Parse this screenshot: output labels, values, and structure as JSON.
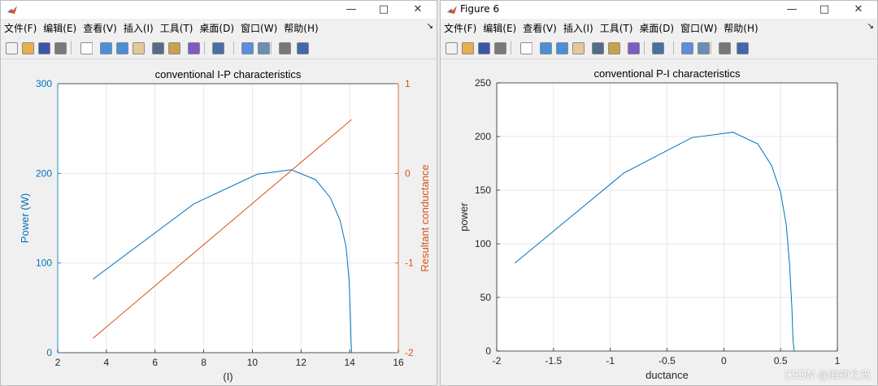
{
  "windows": [
    {
      "id": "w1",
      "title": ""
    },
    {
      "id": "w2",
      "title": "Figure 6"
    }
  ],
  "menus": [
    "文件(F)",
    "编辑(E)",
    "查看(V)",
    "插入(I)",
    "工具(T)",
    "桌面(D)",
    "窗口(W)",
    "帮助(H)"
  ],
  "toolbar_icons": [
    "new-file-icon",
    "open-folder-icon",
    "save-icon",
    "print-icon",
    "pointer-icon",
    "zoom-in-icon",
    "zoom-out-icon",
    "pan-icon",
    "rotate-3d-icon",
    "data-cursor-icon",
    "brush-icon",
    "link-plot-icon",
    "colorbar-icon",
    "legend-icon",
    "hide-plot-tools-icon",
    "show-plot-tools-icon"
  ],
  "colors": {
    "blue": "#0072BD",
    "orange": "#D95319",
    "axis": "#262626",
    "grid": "#e6e6e6"
  },
  "watermark": "CSDN @海神之光",
  "chart_data": [
    {
      "type": "line",
      "title": "conventional I-P characteristics",
      "xlabel": "(I)",
      "ylabel": "Power (W)",
      "ylabel_right": "Resultant conductance",
      "xlim": [
        2,
        16
      ],
      "ylim": [
        0,
        300
      ],
      "ylim_right": [
        -2,
        1
      ],
      "xticks": [
        2,
        4,
        6,
        8,
        10,
        12,
        14,
        16
      ],
      "yticks": [
        0,
        100,
        200,
        300
      ],
      "yticks_right": [
        -2,
        -1,
        0,
        1
      ],
      "grid": true,
      "series": [
        {
          "axis": "left",
          "color": "#0072BD",
          "x": [
            3.45,
            7.6,
            10.2,
            11.6,
            12.6,
            13.2,
            13.6,
            13.85,
            13.98,
            14.03,
            14.06,
            14.08
          ],
          "y": [
            82,
            166,
            199,
            204,
            193,
            173,
            148,
            118,
            80,
            40,
            10,
            0
          ]
        },
        {
          "axis": "right",
          "color": "#D95319",
          "x": [
            3.45,
            14.08
          ],
          "y": [
            -1.84,
            0.6
          ]
        }
      ]
    },
    {
      "type": "line",
      "title": "conventional P-I characteristics",
      "xlabel": "ductance",
      "ylabel": "power",
      "xlim": [
        -2,
        1
      ],
      "ylim": [
        0,
        250
      ],
      "xticks": [
        -2,
        -1.5,
        -1,
        -0.5,
        0,
        0.5,
        1
      ],
      "yticks": [
        0,
        50,
        100,
        150,
        200,
        250
      ],
      "grid": true,
      "series": [
        {
          "color": "#0072BD",
          "x": [
            -1.84,
            -0.88,
            -0.28,
            0.08,
            0.3,
            0.42,
            0.5,
            0.55,
            0.58,
            0.6,
            0.61,
            0.62
          ],
          "y": [
            82,
            166,
            199,
            204,
            193,
            173,
            148,
            118,
            80,
            40,
            10,
            0
          ]
        }
      ]
    }
  ]
}
